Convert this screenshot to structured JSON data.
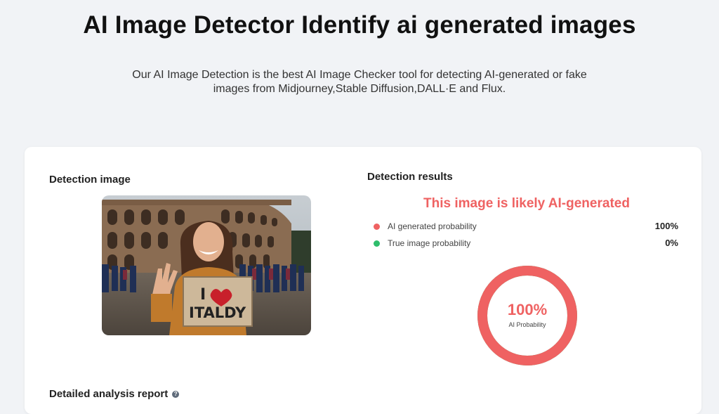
{
  "header": {
    "title": "AI Image Detector Identify ai generated images",
    "subtitle": "Our AI Image Detection is the best AI Image Checker tool for detecting AI-generated or fake images from Midjourney,Stable Diffusion,DALL·E and Flux."
  },
  "card": {
    "detection_image_label": "Detection image",
    "detection_results_label": "Detection results",
    "verdict": "This image is likely AI-generated",
    "probabilities": [
      {
        "label": "AI generated probability",
        "value": "100%",
        "color": "#ef6262"
      },
      {
        "label": "True image probability",
        "value": "0%",
        "color": "#2ebd6b"
      }
    ],
    "donut": {
      "value": "100%",
      "caption": "AI Probability",
      "ai_fraction": 1.0,
      "color": "#ef6262"
    },
    "report_label": "Detailed analysis report",
    "help_icon": "question-circle-icon",
    "photo_sign_text": "I ♥ ITALDY"
  }
}
